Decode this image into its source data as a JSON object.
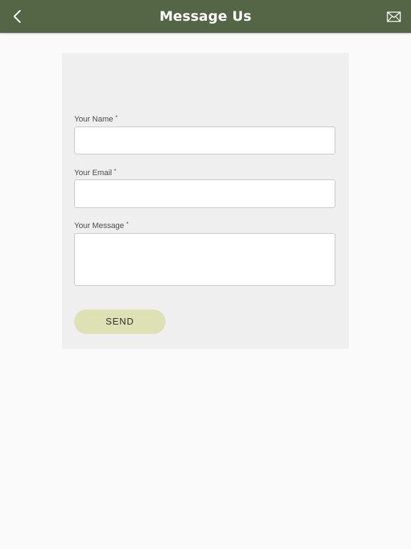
{
  "header": {
    "title": "Message Us",
    "back_icon": "chevron-left-icon",
    "mail_icon": "envelope-icon",
    "background_color": "#556647"
  },
  "form": {
    "fields": [
      {
        "label": "Your Name",
        "required_mark": "*",
        "value": "",
        "placeholder": ""
      },
      {
        "label": "Your Email",
        "required_mark": "*",
        "value": "",
        "placeholder": ""
      },
      {
        "label": "Your Message",
        "required_mark": "*",
        "value": "",
        "placeholder": ""
      }
    ],
    "send_label": "SEND",
    "send_color": "#dde1b4"
  }
}
